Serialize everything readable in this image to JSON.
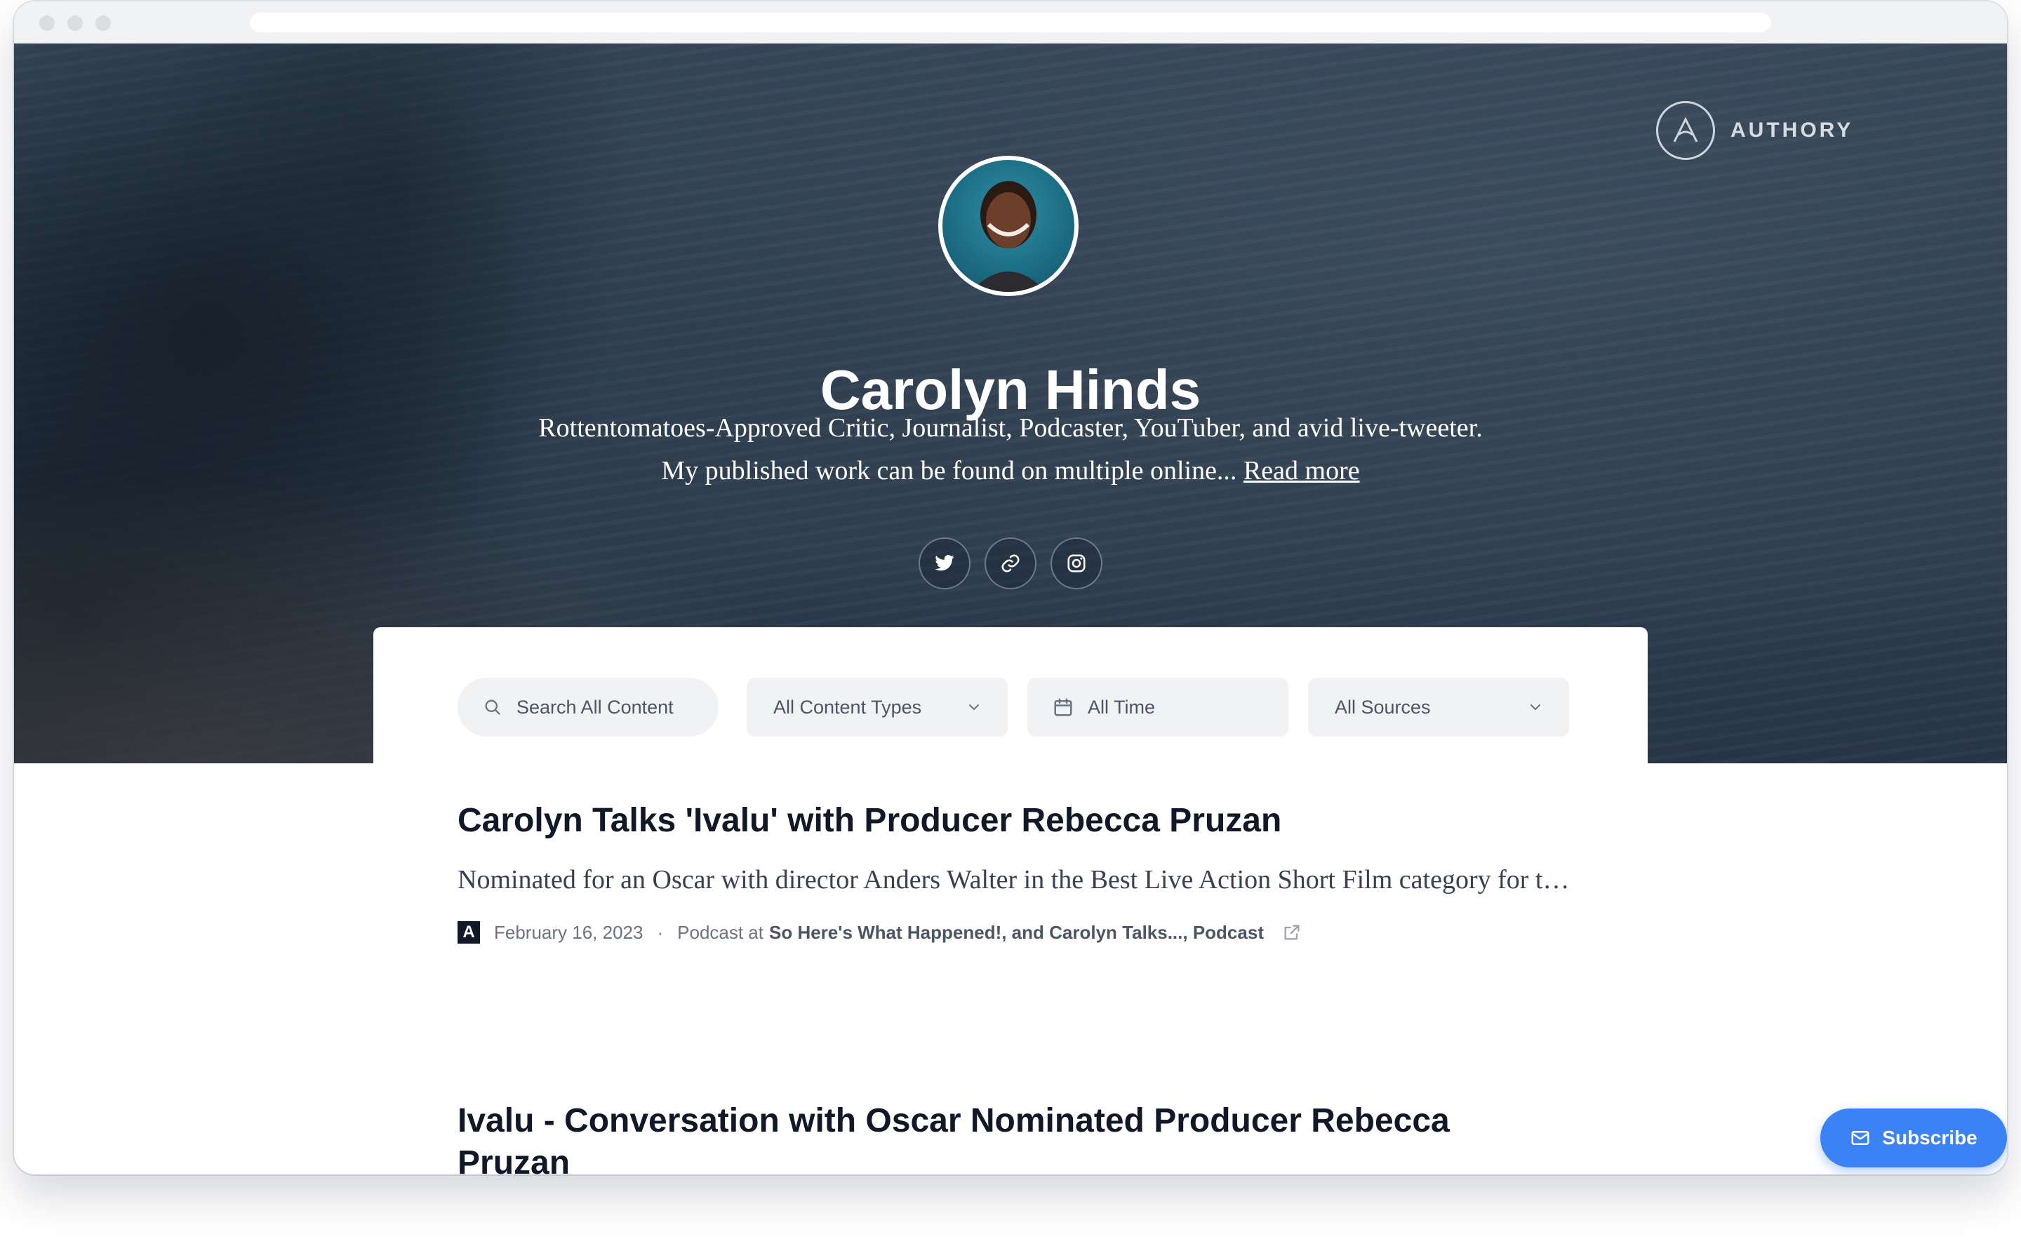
{
  "brand": {
    "name": "AUTHORY"
  },
  "profile": {
    "name": "Carolyn Hinds",
    "bio": "Rottentomatoes-Approved Critic, Journalist, Podcaster, YouTuber, and avid live-tweeter. My published work can be found on multiple online...",
    "read_more": "Read more"
  },
  "socials": [
    {
      "icon": "twitter-icon"
    },
    {
      "icon": "link-icon"
    },
    {
      "icon": "instagram-icon"
    }
  ],
  "filters": {
    "search_placeholder": "Search All Content",
    "content_types": "All Content Types",
    "time": "All Time",
    "sources": "All Sources"
  },
  "articles": [
    {
      "title": "Carolyn Talks 'Ivalu' with Producer Rebecca Pruzan",
      "description": "Nominated for an Oscar with director Anders Walter in the Best Live Action Short Film category for their Danish film IVALU, Rebecca joined me in this episode of Carolyn Talks..., t...",
      "source_logo": "A",
      "date": "February 16, 2023",
      "separator": "·",
      "type_prefix": "Podcast at",
      "publications": "So Here's What Happened!, and Carolyn Talks..., Podcast"
    },
    {
      "title": "Ivalu - Conversation with Oscar Nominated Producer Rebecca Pruzan"
    }
  ],
  "subscribe": {
    "label": "Subscribe"
  },
  "colors": {
    "accent": "#3b82f6",
    "hero_overlay": "#2f4052"
  }
}
